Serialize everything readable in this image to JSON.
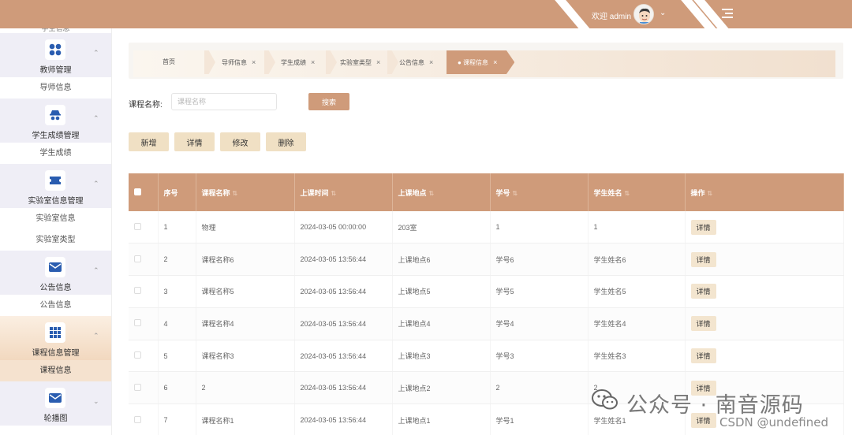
{
  "header": {
    "welcome": "欢迎 admin",
    "accent_color": "#cf9b7a"
  },
  "sidebar": {
    "top_cut_label": "学生信息",
    "groups": [
      {
        "label": "教师管理",
        "icon": "grid-dots-icon",
        "sub": [
          "导师信息"
        ]
      },
      {
        "label": "学生成绩管理",
        "icon": "spy-icon",
        "sub": [
          "学生成绩"
        ]
      },
      {
        "label": "实验室信息管理",
        "icon": "ticket-icon",
        "sub": [
          "实验室信息",
          "实验室类型"
        ]
      },
      {
        "label": "公告信息",
        "icon": "mail-icon",
        "sub": [
          "公告信息"
        ]
      },
      {
        "label": "课程信息管理",
        "icon": "grid-9-icon",
        "sub": [
          "课程信息"
        ]
      },
      {
        "label": "轮播图",
        "icon": "mail-icon",
        "sub": []
      }
    ]
  },
  "breadcrumbs": [
    {
      "label": "首页"
    },
    {
      "label": "导师信息",
      "close": "×"
    },
    {
      "label": "学生成绩",
      "close": "×"
    },
    {
      "label": "实验室类型",
      "close": "×"
    },
    {
      "label": "公告信息",
      "close": "×"
    },
    {
      "label": "● 课程信息",
      "close": "×"
    }
  ],
  "search": {
    "label": "课程名称:",
    "placeholder": "课程名称",
    "button": "搜索"
  },
  "actions": [
    "新增",
    "详情",
    "修改",
    "删除"
  ],
  "table": {
    "columns": [
      "序号",
      "课程名称",
      "上课时间",
      "上课地点",
      "学号",
      "学生姓名",
      "操作"
    ],
    "row_action": "详情",
    "rows": [
      [
        "1",
        "物理",
        "2024-03-05 00:00:00",
        "203室",
        "1",
        "1"
      ],
      [
        "2",
        "课程名称6",
        "2024-03-05 13:56:44",
        "上课地点6",
        "学号6",
        "学生姓名6"
      ],
      [
        "3",
        "课程名称5",
        "2024-03-05 13:56:44",
        "上课地点5",
        "学号5",
        "学生姓名5"
      ],
      [
        "4",
        "课程名称4",
        "2024-03-05 13:56:44",
        "上课地点4",
        "学号4",
        "学生姓名4"
      ],
      [
        "5",
        "课程名称3",
        "2024-03-05 13:56:44",
        "上课地点3",
        "学号3",
        "学生姓名3"
      ],
      [
        "6",
        "2",
        "2024-03-05 13:56:44",
        "上课地点2",
        "2",
        "2"
      ],
      [
        "7",
        "课程名称1",
        "2024-03-05 13:56:44",
        "上课地点1",
        "学号1",
        "学生姓名1"
      ]
    ]
  },
  "watermark": {
    "title": "公众号 · 南音源码",
    "csdn": "CSDN @undefined"
  }
}
